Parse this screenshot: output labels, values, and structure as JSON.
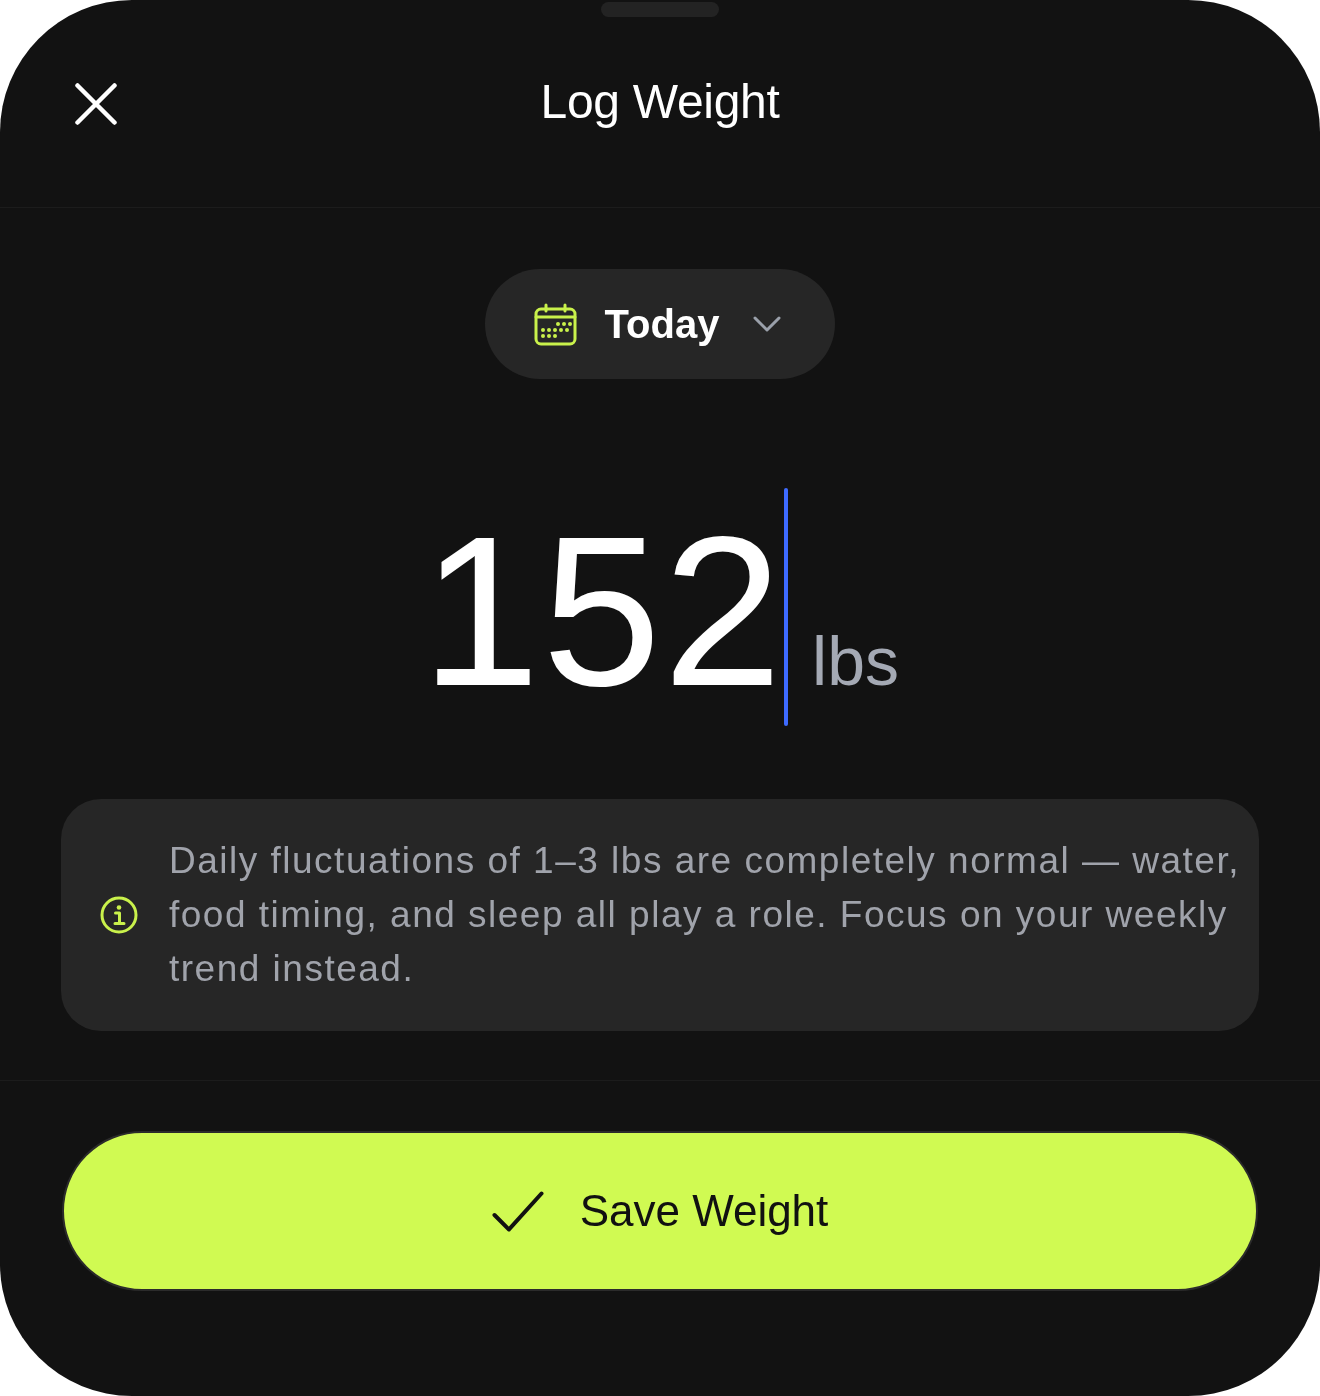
{
  "header": {
    "title": "Log Weight"
  },
  "date_picker": {
    "label": "Today"
  },
  "weight_entry": {
    "value": "152",
    "unit": "lbs",
    "focused": true
  },
  "info_note": {
    "text": "Daily fluctuations of 1–3 lbs are completely normal — water, food timing, and sleep all play a role. Focus on your weekly trend instead."
  },
  "primary_button": {
    "label": "Save Weight"
  }
}
